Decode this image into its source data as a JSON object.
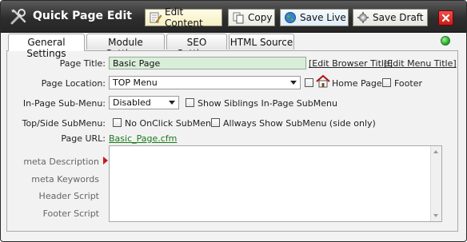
{
  "window": {
    "title": "Quick Page Edit",
    "toolbar": {
      "edit_content": "Edit Content",
      "copy": "Copy",
      "save_live": "Save Live",
      "save_draft": "Save Draft"
    },
    "status_color": "#18a018"
  },
  "tabs": [
    {
      "label": "General Settings",
      "active": true
    },
    {
      "label": "Module Settings"
    },
    {
      "label": "SEO Settings"
    },
    {
      "label": "HTML Source"
    }
  ],
  "form": {
    "page_title": {
      "label": "Page Title:",
      "value": "Basic Page",
      "links": [
        "[Edit Browser Title]",
        "[Edit Menu Title]"
      ]
    },
    "page_location": {
      "label": "Page Location:",
      "value": "TOP Menu",
      "home_page_label": "Home Page",
      "footer_label": "Footer"
    },
    "in_page_submenu": {
      "label": "In-Page Sub-Menu:",
      "value": "Disabled",
      "checkbox_label": "Show Siblings In-Page SubMenu"
    },
    "top_side_submenu": {
      "label": "Top/Side SubMenu:",
      "options": [
        "No OnClick SubMenu",
        "Allways Show SubMenu (side only)"
      ]
    },
    "page_url": {
      "label": "Page URL:",
      "value": "Basic_Page.cfm"
    },
    "meta_tabs": [
      "meta Description",
      "meta Keywords",
      "Header Script",
      "Footer Script"
    ]
  }
}
